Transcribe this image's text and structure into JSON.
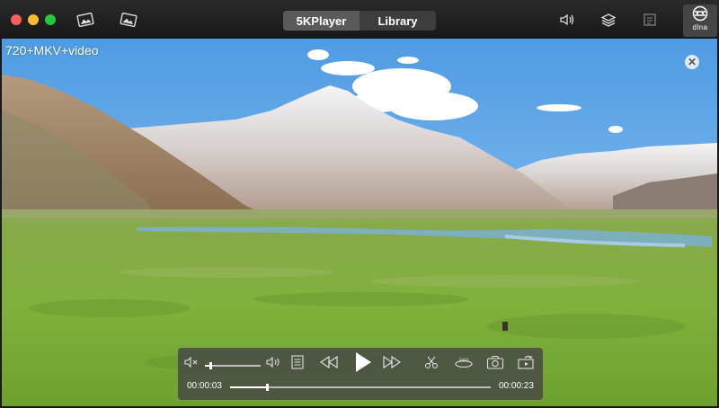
{
  "window": {
    "tabs": [
      {
        "label": "5KPlayer",
        "active": true
      },
      {
        "label": "Library",
        "active": false
      }
    ],
    "dlna_label": "dlna"
  },
  "video": {
    "title": "720+MKV+video",
    "close_glyph": "✕"
  },
  "controls": {
    "current_time": "00:00:03",
    "total_time": "00:00:23",
    "volume_level": 0.1,
    "progress": 0.14
  },
  "icons": [
    "mute-icon",
    "volume-icon",
    "playlist-icon",
    "rewind-icon",
    "play-icon",
    "fast-forward-icon",
    "scissors-icon",
    "airplay-360-icon",
    "snapshot-icon",
    "rotate-icon",
    "speaker-icon",
    "layers-icon",
    "subtitle-icon",
    "dlna-icon",
    "photo-icon"
  ]
}
